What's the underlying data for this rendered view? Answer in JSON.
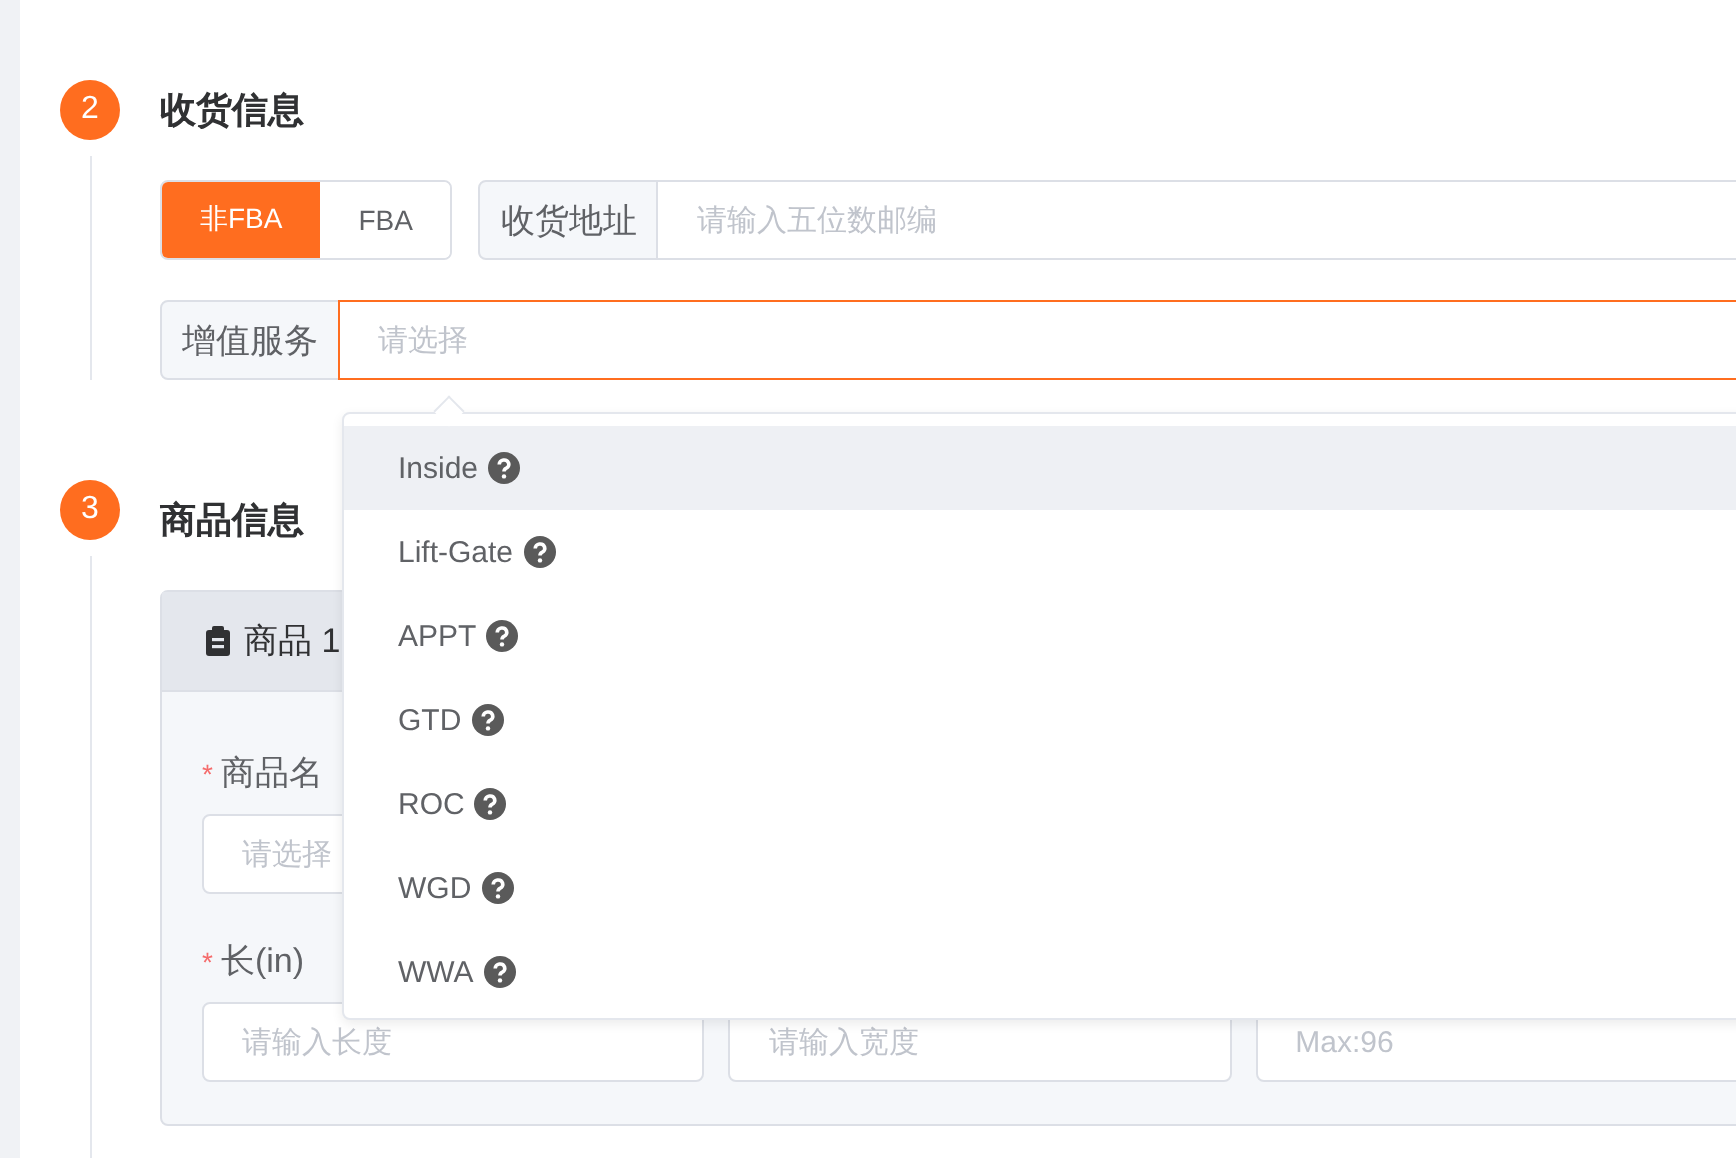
{
  "sections": [
    {
      "number": "2",
      "title": "收货信息"
    },
    {
      "number": "3",
      "title": "商品信息"
    }
  ],
  "shipping": {
    "modes": [
      {
        "label": "非FBA",
        "selected": true
      },
      {
        "label": "FBA",
        "selected": false
      }
    ],
    "address": {
      "label": "收货地址",
      "placeholder": "请输入五位数邮编"
    },
    "service": {
      "label": "增值服务",
      "placeholder": "请选择",
      "focused": true
    }
  },
  "dropdown": {
    "options": [
      {
        "label": "Inside",
        "highlighted": true
      },
      {
        "label": "Lift-Gate",
        "highlighted": false
      },
      {
        "label": "APPT",
        "highlighted": false
      },
      {
        "label": "GTD",
        "highlighted": false
      },
      {
        "label": "ROC",
        "highlighted": false
      },
      {
        "label": "WGD",
        "highlighted": false
      },
      {
        "label": "WWA",
        "highlighted": false
      }
    ]
  },
  "product": {
    "card_title": "商品 1",
    "name_field": {
      "mark": "*",
      "label": "商品名",
      "placeholder": "请选择"
    },
    "size_label": {
      "mark": "*",
      "label": "长(in)"
    },
    "size_fields": [
      {
        "placeholder": "请输入长度"
      },
      {
        "placeholder": "请输入宽度"
      },
      {
        "placeholder": "Max:96"
      }
    ]
  }
}
